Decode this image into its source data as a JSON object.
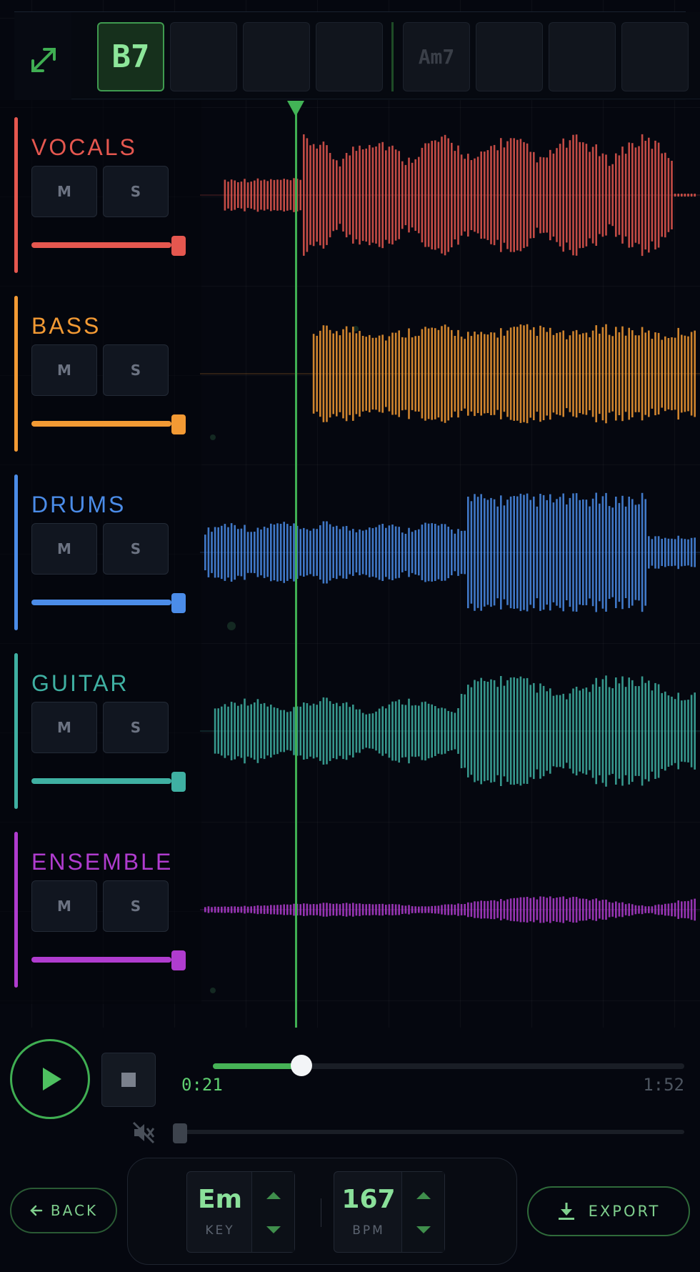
{
  "chords": [
    {
      "label": "B7",
      "active": true
    },
    {
      "label": "",
      "active": false
    },
    {
      "label": "",
      "active": false
    },
    {
      "label": "",
      "active": false
    },
    {
      "label": "Am7",
      "active": false
    },
    {
      "label": "",
      "active": false
    },
    {
      "label": "",
      "active": false
    },
    {
      "label": "",
      "active": false
    }
  ],
  "tracks": [
    {
      "name": "VOCALS",
      "color": "#e5574f",
      "mute": "M",
      "solo": "S",
      "volume": 1.0
    },
    {
      "name": "BASS",
      "color": "#f39a34",
      "mute": "M",
      "solo": "S",
      "volume": 1.0
    },
    {
      "name": "DRUMS",
      "color": "#4b8ce8",
      "mute": "M",
      "solo": "S",
      "volume": 1.0
    },
    {
      "name": "GUITAR",
      "color": "#3fb0a2",
      "mute": "M",
      "solo": "S",
      "volume": 1.0
    },
    {
      "name": "ENSEMBLE",
      "color": "#b03ccf",
      "mute": "M",
      "solo": "S",
      "volume": 1.0
    }
  ],
  "transport": {
    "current_time": "0:21",
    "total_time": "1:52",
    "progress": 0.1875,
    "master_volume": 0.0
  },
  "controls": {
    "back_label": "BACK",
    "key_value": "Em",
    "key_label": "KEY",
    "bpm_value": "167",
    "bpm_label": "BPM",
    "export_label": "EXPORT"
  },
  "colors": {
    "accent": "#42b356"
  }
}
